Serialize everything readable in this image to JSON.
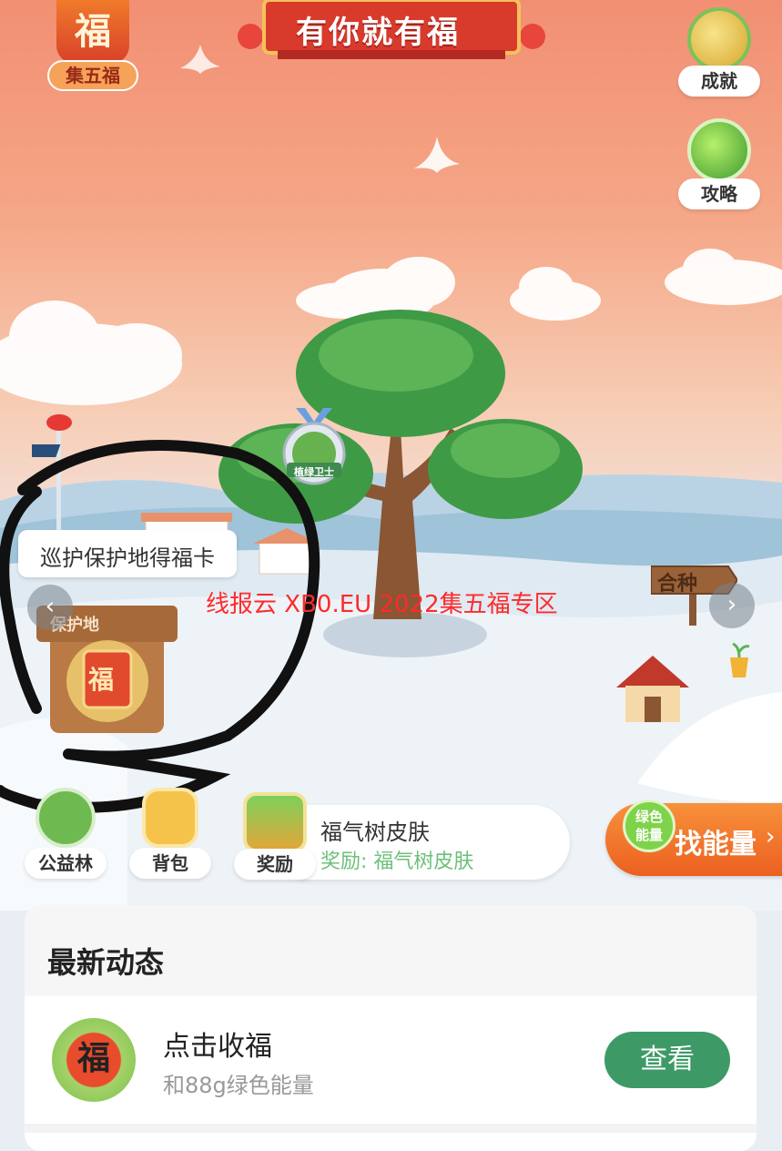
{
  "header": {
    "fu_char": "福",
    "collect_label": "集五福",
    "banner_title": "有你就有福"
  },
  "right_buttons": {
    "achievement_label": "成就",
    "strategy_label": "攻略"
  },
  "tree": {
    "badge_label": "植绿卫士"
  },
  "patrol": {
    "tooltip": "巡护保护地得福卡",
    "sign_label": "保护地",
    "card_char": "福"
  },
  "plant_sign": "合种",
  "watermark": "线报云 XB0.EU 2022集五福专区",
  "bottom_bar": {
    "forest_label": "公益林",
    "bag_label": "背包",
    "reward_label": "奖励",
    "skin_title": "福气树皮肤",
    "skin_reward": "奖励: 福气树皮肤",
    "energy_bubble": "绿色能量",
    "find_energy": "找能量"
  },
  "feed": {
    "title": "最新动态",
    "item": {
      "icon_char": "福",
      "title": "点击收福",
      "subtitle": "和88g绿色能量",
      "action": "查看"
    }
  },
  "colors": {
    "sky_top": "#f28f73",
    "sky_bottom": "#f6c9ae",
    "accent_green": "#3d9a66",
    "accent_orange": "#f27127",
    "banner_red": "#d83a2c",
    "watermark_red": "#ff2a2a"
  }
}
